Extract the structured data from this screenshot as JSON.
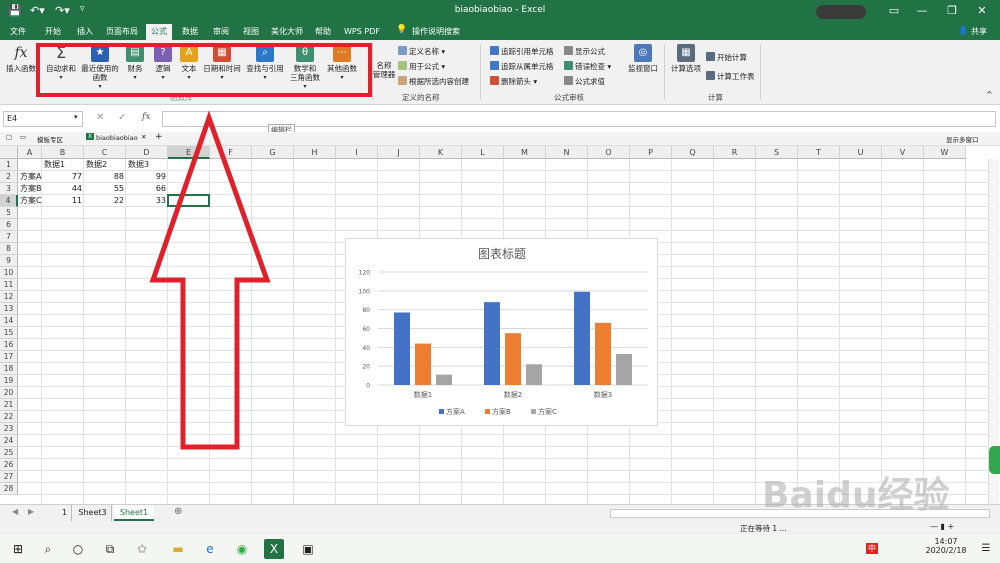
{
  "window": {
    "title": "biaobiaobiao - Excel",
    "share": "共享"
  },
  "tabs": [
    "文件",
    "开始",
    "插入",
    "页面布局",
    "公式",
    "数据",
    "审阅",
    "视图",
    "美化大师",
    "帮助",
    "WPS PDF"
  ],
  "tell_me": "操作说明搜索",
  "ribbon": {
    "insert_function": "插入函数",
    "library": [
      {
        "label": "自动求和",
        "icon": "Σ",
        "color": "#555555"
      },
      {
        "label": "最近使用的\n函数",
        "icon": "★",
        "color": "#2b5fb4"
      },
      {
        "label": "财务",
        "icon": "▤",
        "color": "#3f8f6f"
      },
      {
        "label": "逻辑",
        "icon": "?",
        "color": "#7b5fb3"
      },
      {
        "label": "文本",
        "icon": "A",
        "color": "#e3a11c"
      },
      {
        "label": "日期和时间",
        "icon": "▦",
        "color": "#d24d35"
      },
      {
        "label": "查找与引用",
        "icon": "⌕",
        "color": "#2a78c6"
      },
      {
        "label": "数学和\n三角函数",
        "icon": "θ",
        "color": "#3f8f6f"
      },
      {
        "label": "其他函数",
        "icon": "⋯",
        "color": "#e07b25"
      }
    ],
    "library_group": "函数库",
    "name_manager": "名称\n管理器",
    "define_name": "定义名称",
    "use_in_formula": "用于公式",
    "create_from_selection": "根据所选内容创建",
    "names_group": "定义的名称",
    "trace_precedents": "追踪引用单元格",
    "trace_dependents": "追踪从属单元格",
    "remove_arrows": "删除箭头",
    "show_formulas": "显示公式",
    "error_checking": "错误检查",
    "evaluate_formula": "公式求值",
    "audit_group": "公式审核",
    "watch_window": "监视窗口",
    "calc_options": "计算选项",
    "calc_now": "开始计算",
    "calc_sheet": "计算工作表",
    "calc_group": "计算"
  },
  "formula_bar": {
    "name_box": "E4",
    "value": "",
    "tooltip": "编辑栏"
  },
  "workbook_tabs": {
    "template": "模板专区",
    "file": "biaobiaobiao",
    "multi_window": "显示多窗口"
  },
  "columns": [
    "A",
    "B",
    "C",
    "D",
    "E",
    "F",
    "G",
    "H",
    "I",
    "J",
    "K",
    "L",
    "M",
    "N",
    "O",
    "P",
    "Q",
    "R",
    "S",
    "T",
    "U",
    "V",
    "W"
  ],
  "rows": [
    "1",
    "2",
    "3",
    "4",
    "5",
    "6",
    "7",
    "8",
    "9",
    "10",
    "11",
    "12",
    "13",
    "14",
    "15",
    "16",
    "17",
    "18",
    "19",
    "20",
    "21",
    "22",
    "23",
    "24",
    "25",
    "26",
    "27",
    "28"
  ],
  "cells": {
    "header": [
      "数据1",
      "数据2",
      "数据3"
    ],
    "rows": [
      {
        "label": "方案A",
        "values": [
          "77",
          "88",
          "99"
        ]
      },
      {
        "label": "方案B",
        "values": [
          "44",
          "55",
          "66"
        ]
      },
      {
        "label": "方案C",
        "values": [
          "11",
          "22",
          "33"
        ]
      }
    ]
  },
  "chart_data": {
    "type": "bar",
    "title": "图表标题",
    "categories": [
      "数据1",
      "数据2",
      "数据3"
    ],
    "series": [
      {
        "name": "方案A",
        "values": [
          77,
          88,
          99
        ],
        "color": "#4472c4"
      },
      {
        "name": "方案B",
        "values": [
          44,
          55,
          66
        ],
        "color": "#ed7d31"
      },
      {
        "name": "方案C",
        "values": [
          11,
          22,
          33
        ],
        "color": "#a5a5a5"
      }
    ],
    "ylim": [
      0,
      120
    ],
    "yticks": [
      "0",
      "20",
      "40",
      "60",
      "80",
      "100",
      "120"
    ],
    "grid": true,
    "legend": "bottom"
  },
  "sheets": [
    "Sheet3",
    "Sheet1"
  ],
  "sheet_active": "Sheet1",
  "sheet_prefix": "1",
  "status": {
    "left": "正在等待 1 ..."
  },
  "clock": {
    "time": "14:07",
    "date": "2020/2/18"
  },
  "ime": "中",
  "watermark": "Baidu经验"
}
